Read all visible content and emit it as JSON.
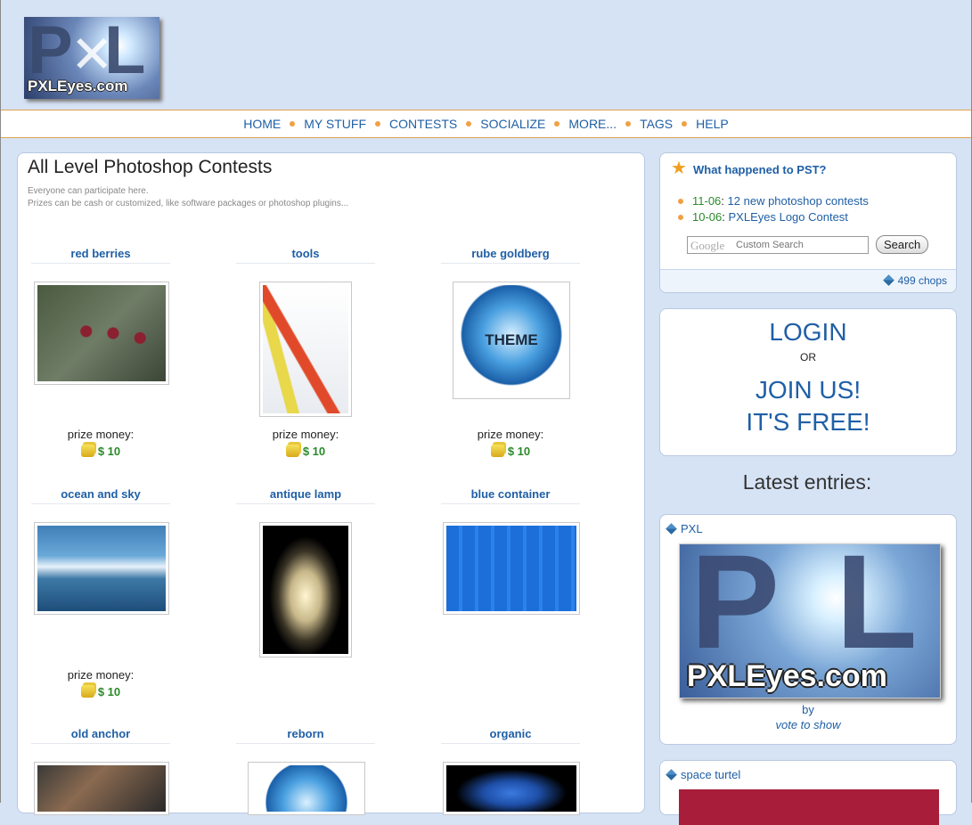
{
  "logo": {
    "text": "PXLEyes.com"
  },
  "nav": [
    "HOME",
    "MY STUFF",
    "CONTESTS",
    "SOCIALIZE",
    "MORE...",
    "TAGS",
    "HELP"
  ],
  "main": {
    "title": "All Level Photoshop Contests",
    "sub1": "Everyone can participate here.",
    "sub2": "Prizes can be cash or customized, like software packages or photoshop plugins...",
    "contests": [
      {
        "title": "red berries",
        "prize_label": "prize money:",
        "prize": "$ 10"
      },
      {
        "title": "tools",
        "prize_label": "prize money:",
        "prize": "$ 10"
      },
      {
        "title": "rube goldberg",
        "prize_label": "prize money:",
        "prize": "$ 10",
        "image_text": "THEME"
      },
      {
        "title": "ocean and sky",
        "prize_label": "prize money:",
        "prize": "$ 10"
      },
      {
        "title": "antique lamp"
      },
      {
        "title": "blue container"
      },
      {
        "title": "old anchor"
      },
      {
        "title": "reborn"
      },
      {
        "title": "organic"
      }
    ]
  },
  "sidebar": {
    "pst_title": "What happened to PST?",
    "news": [
      {
        "date": "11-06",
        "sep": ":",
        "text": "12 new photoshop contests"
      },
      {
        "date": "10-06",
        "sep": ":",
        "text": "PXLEyes Logo Contest"
      }
    ],
    "search": {
      "placeholder": "Custom Search",
      "brand": "Google",
      "button": "Search"
    },
    "chops": "499 chops",
    "login": "LOGIN",
    "or": "OR",
    "join1": "JOIN US!",
    "join2": "IT'S FREE!",
    "latest": "Latest entries:",
    "entries": [
      {
        "name": "PXL",
        "by": "by",
        "vote": "vote to show",
        "image_text": "PXLEyes.com"
      },
      {
        "name": "space turtel"
      }
    ]
  },
  "colors": {
    "accent": "#1f5fa6",
    "prize_green": "#2a8a2a",
    "nav_dot": "#f0a045",
    "page_bg": "#d6e3f5"
  }
}
